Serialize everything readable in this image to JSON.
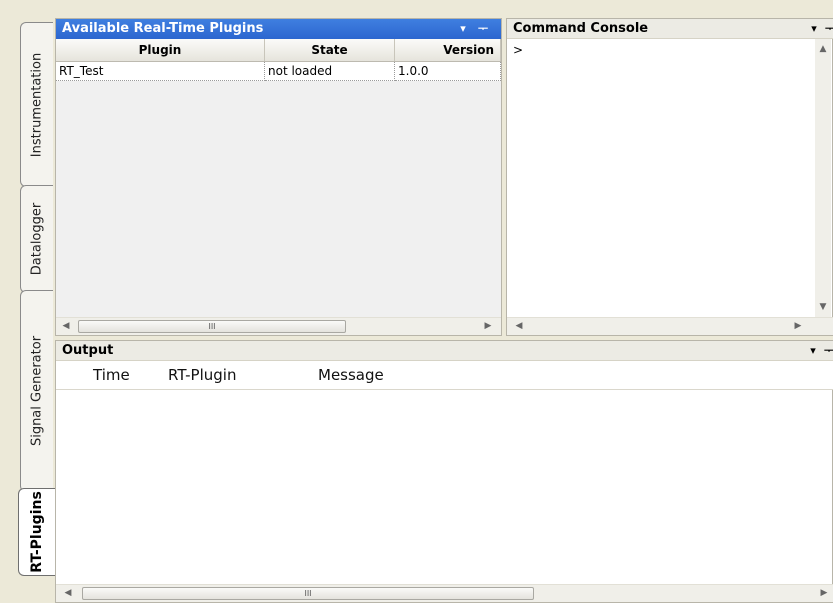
{
  "sidebar": {
    "tabs": [
      {
        "label": "Instrumentation"
      },
      {
        "label": "Datalogger"
      },
      {
        "label": "Signal Generator"
      },
      {
        "label": "RT-Plugins"
      }
    ]
  },
  "plugins_panel": {
    "title": "Available Real-Time Plugins",
    "dropdown_glyph": "▾",
    "pin_glyph": "ᅮ",
    "columns": [
      "Plugin",
      "State",
      "Version"
    ],
    "rows": [
      {
        "plugin": "RT_Test",
        "state": "not loaded",
        "version": "1.0.0"
      }
    ],
    "scroll_thumb_glyph": "III"
  },
  "console_panel": {
    "title": "Command Console",
    "prompt": ">"
  },
  "output_panel": {
    "title": "Output",
    "columns": [
      "Time",
      "RT-Plugin",
      "Message"
    ],
    "scroll_thumb_glyph": "III"
  }
}
